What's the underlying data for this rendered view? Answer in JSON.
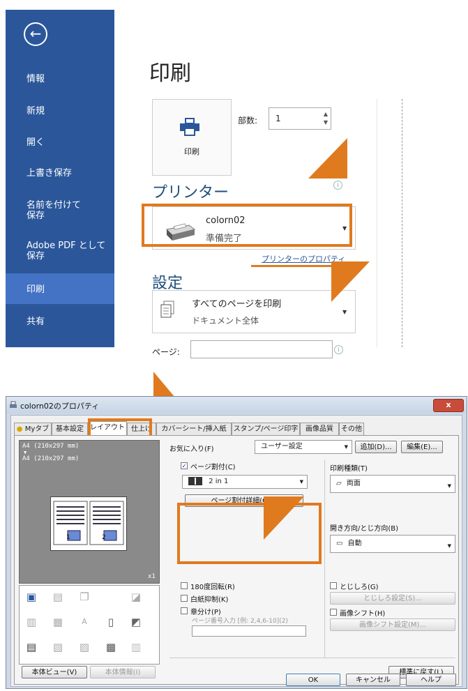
{
  "backstage": {
    "title": "印刷",
    "sidebar": {
      "items": [
        {
          "label": "情報"
        },
        {
          "label": "新規"
        },
        {
          "label": "開く"
        },
        {
          "label": "上書き保存"
        },
        {
          "label": "名前を付けて\n保存"
        },
        {
          "label": "Adobe PDF として\n保存"
        },
        {
          "label": "印刷"
        },
        {
          "label": "共有"
        }
      ],
      "active_label": "印刷"
    },
    "print_button": {
      "label": "印刷"
    },
    "copies": {
      "label": "部数:",
      "value": "1"
    },
    "printer_section": {
      "title": "プリンター",
      "name": "colorn02",
      "status": "準備完了",
      "properties_link": "プリンターのプロパティ"
    },
    "settings_section": {
      "title": "設定",
      "pages_main": "すべてのページを印刷",
      "pages_sub": "ドキュメント全体",
      "pages_label": "ページ:"
    }
  },
  "dialog": {
    "title": "colorn02のプロパティ",
    "close": "x",
    "tabs": [
      {
        "label": "Myタブ"
      },
      {
        "label": "基本設定"
      },
      {
        "label": "レイアウト"
      },
      {
        "label": "仕上げ"
      },
      {
        "label": "カバーシート/挿入紙"
      },
      {
        "label": "スタンプ/ページ印字"
      },
      {
        "label": "画像品質"
      },
      {
        "label": "その他"
      }
    ],
    "active_tab": "レイアウト",
    "preview": {
      "line1": "A4 (210x297 mm)",
      "arrow": "▼",
      "line2": "A4 (210x297 mm)",
      "scale": "x1"
    },
    "favorites": {
      "label": "お気に入り(F)",
      "value": "ユーザー設定",
      "add_button": "追加(D)...",
      "edit_button": "編集(E)..."
    },
    "nup": {
      "checkbox_label": "ページ割付(C)",
      "checked": true,
      "value": "2 in 1",
      "detail_button": "ページ割付詳細(O)..."
    },
    "print_type": {
      "label": "印刷種類(T)",
      "value": "両面"
    },
    "open_direction": {
      "label": "開き方向/とじ方向(B)",
      "value": "自動"
    },
    "rotate180": {
      "label": "180度回転(R)"
    },
    "blank_suppress": {
      "label": "白紙抑制(K)"
    },
    "chapter": {
      "label": "章分け(P)",
      "hint": "ページ番号入力 [例: 2,4,6-10](2)"
    },
    "binding_margin": {
      "label": "とじしろ(G)",
      "button": "とじしろ設定(S)..."
    },
    "image_shift": {
      "label": "画像シフト(H)",
      "button": "画像シフト設定(M)..."
    },
    "view_button": "本体ビュー(V)",
    "info_button": "本体情報(I)",
    "default_button": "標準に戻す(L)",
    "ok_button": "OK",
    "cancel_button": "キャンセル",
    "help_button": "ヘルプ"
  },
  "colors": {
    "accent_orange": "#e07a1f",
    "sidebar_blue": "#2b579a",
    "sidebar_active": "#4472c4"
  }
}
